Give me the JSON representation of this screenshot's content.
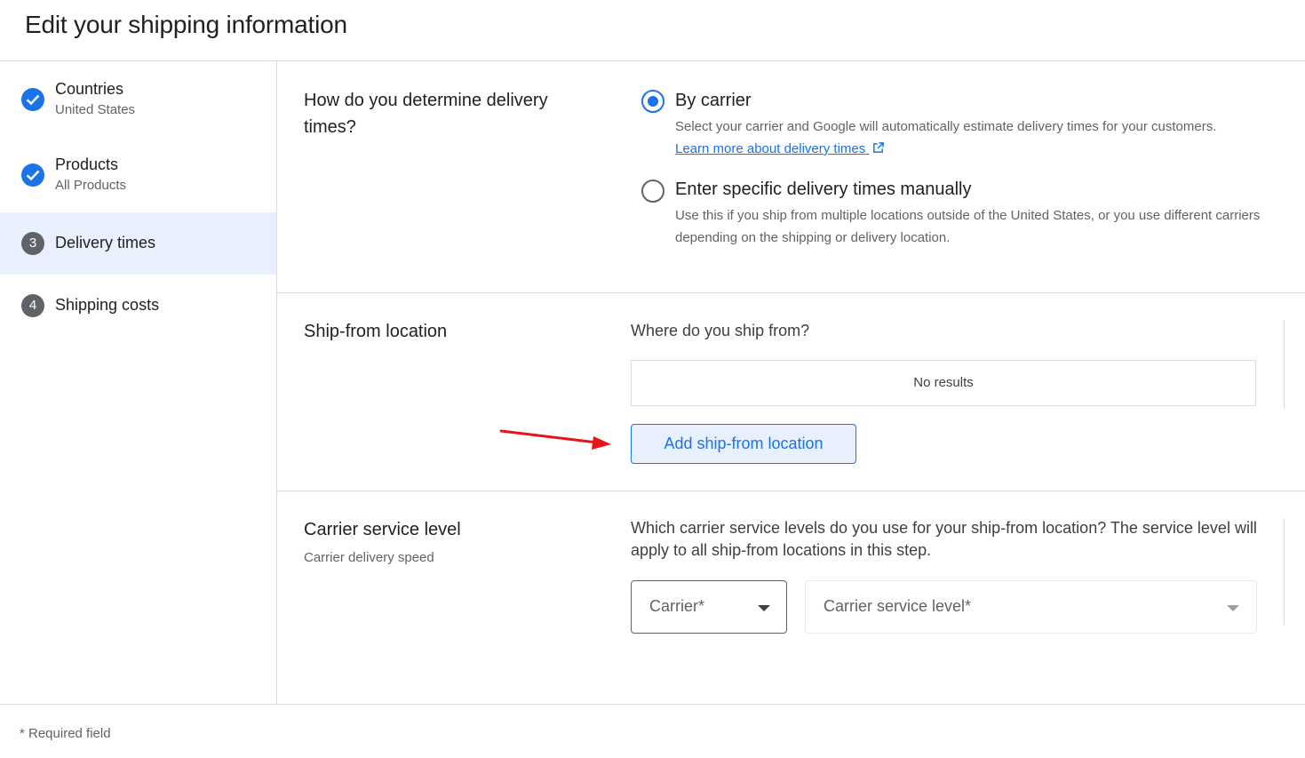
{
  "header": {
    "title": "Edit your shipping information"
  },
  "sidebar": {
    "steps": [
      {
        "title": "Countries",
        "subtitle": "United States",
        "status": "done",
        "icon": "check-icon"
      },
      {
        "title": "Products",
        "subtitle": "All Products",
        "status": "done",
        "icon": "check-icon"
      },
      {
        "number": "3",
        "title": "Delivery times",
        "status": "active"
      },
      {
        "number": "4",
        "title": "Shipping costs",
        "status": "pending"
      }
    ]
  },
  "delivery": {
    "title": "How do you determine delivery times?",
    "options": [
      {
        "label": "By carrier",
        "selected": true,
        "description": "Select your carrier and Google will automatically estimate delivery times for your customers.",
        "link": "Learn more about delivery times"
      },
      {
        "label": "Enter specific delivery times manually",
        "selected": false,
        "description": "Use this if you ship from multiple locations outside of the United States, or you use different carriers depending on the shipping or delivery location."
      }
    ]
  },
  "ship_from": {
    "title": "Ship-from location",
    "question": "Where do you ship from?",
    "empty_text": "No results",
    "add_button": "Add ship-from location"
  },
  "carrier": {
    "title": "Carrier service level",
    "subtitle": "Carrier delivery speed",
    "question": "Which carrier service levels do you use for your ship-from location? The service level will apply to all ship-from locations in this step.",
    "carrier_select": "Carrier*",
    "service_select": "Carrier service level*"
  },
  "footer": {
    "note": "* Required field"
  },
  "colors": {
    "accent": "#1a73e8",
    "active_bg": "#e8f0fe",
    "annotation_arrow": "#e8141a"
  }
}
